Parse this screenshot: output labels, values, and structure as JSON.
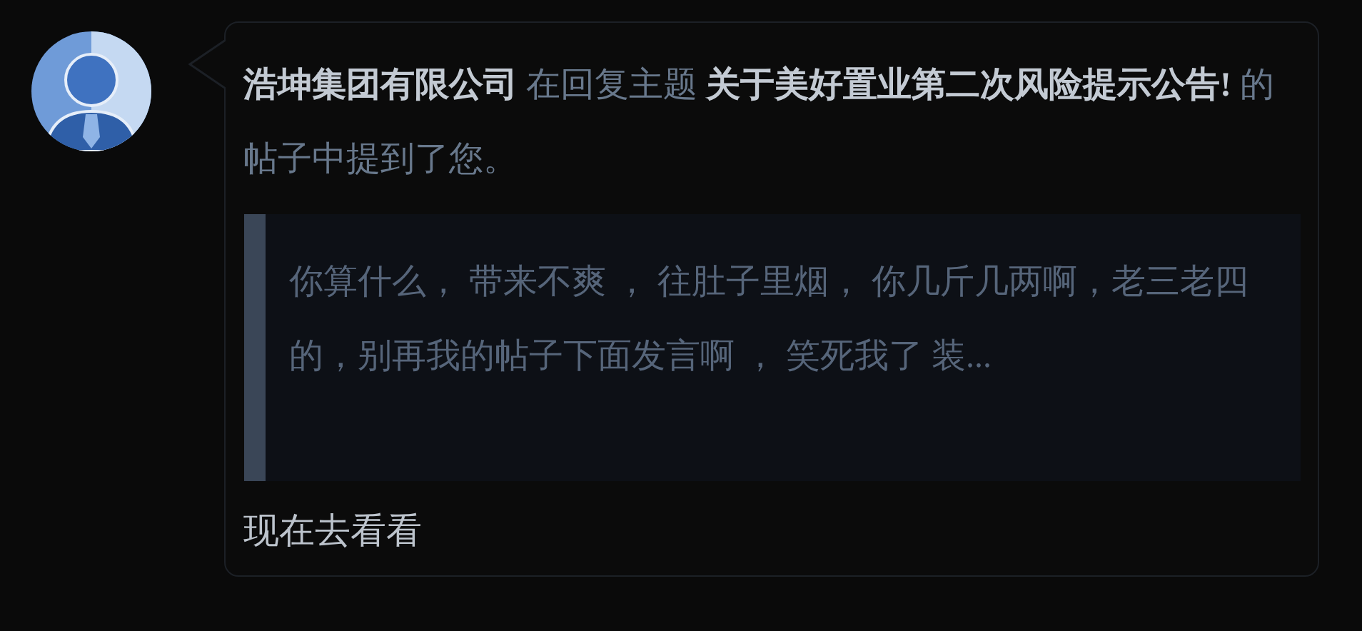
{
  "notification": {
    "message": "**浩坤集团有限公司** 在回复主题 **关于美好置业第二次风险提示公告!** 的帖子中提到了您。",
    "quote": "你算什么， 带来不爽 ， 往肚子里烟， 你几斤几两啊，老三老四的，别再我的帖子下面发言啊 ， 笑死我了 装...",
    "link": "现在去看看"
  }
}
